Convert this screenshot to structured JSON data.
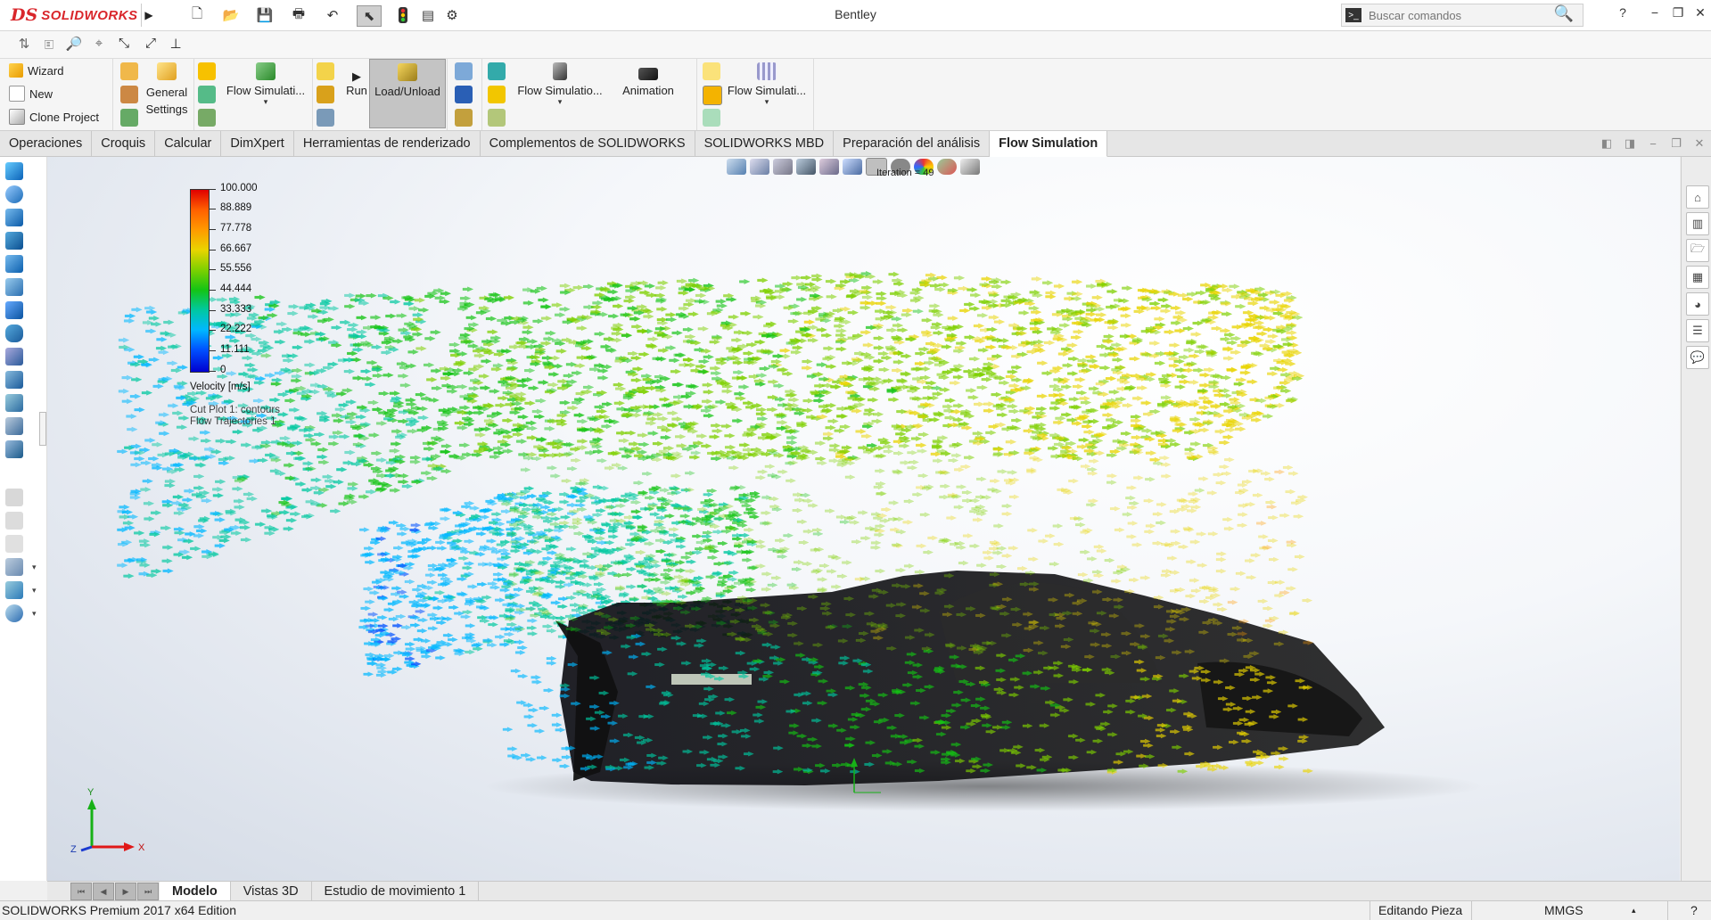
{
  "app": {
    "brand_prefix": "DS",
    "brand_name": "SOLIDWORKS",
    "document_title": "Bentley"
  },
  "search": {
    "placeholder": "Buscar comandos"
  },
  "window_controls": {
    "help": "?",
    "minimize": "−",
    "restore": "❐",
    "close": "✕"
  },
  "ribbon": {
    "wizard_label": "Wizard",
    "new_label": "New",
    "clone_label": "Clone Project",
    "general_settings_label": "General Settings",
    "flow_sim_1_label": "Flow Simulati...",
    "run_label": "Run",
    "load_unload_label": "Load/Unload",
    "flow_sim_2_label": "Flow Simulatio...",
    "animation_label": "Animation",
    "flow_sim_3_label": "Flow Simulati..."
  },
  "command_tabs": [
    {
      "label": "Operaciones",
      "active": false
    },
    {
      "label": "Croquis",
      "active": false
    },
    {
      "label": "Calcular",
      "active": false
    },
    {
      "label": "DimXpert",
      "active": false
    },
    {
      "label": "Herramientas de renderizado",
      "active": false
    },
    {
      "label": "Complementos de SOLIDWORKS",
      "active": false
    },
    {
      "label": "SOLIDWORKS MBD",
      "active": false
    },
    {
      "label": "Preparación del análisis",
      "active": false
    },
    {
      "label": "Flow Simulation",
      "active": true
    }
  ],
  "viewport": {
    "iteration_label": "Iteration = 49",
    "legend": {
      "values": [
        "100.000",
        "88.889",
        "77.778",
        "66.667",
        "55.556",
        "44.444",
        "33.333",
        "22.222",
        "11.111",
        "0"
      ],
      "units_label": "Velocity [m/s]",
      "plot_label_1": "Cut Plot 1: contours",
      "plot_label_2": "Flow Trajectories 1",
      "colors": [
        "#e00000",
        "#ff6000",
        "#ff9a00",
        "#e9d400",
        "#7ed000",
        "#14c414",
        "#00c8a0",
        "#00b8ff",
        "#0050ff",
        "#0000d0"
      ]
    },
    "triad": {
      "x": "X",
      "y": "Y",
      "z": "Z"
    }
  },
  "bottom_tabs": [
    {
      "label": "Modelo",
      "active": true
    },
    {
      "label": "Vistas 3D",
      "active": false
    },
    {
      "label": "Estudio de movimiento 1",
      "active": false
    }
  ],
  "status_bar": {
    "edition": "SOLIDWORKS Premium 2017 x64 Edition",
    "mode": "Editando Pieza",
    "units": "MMGS"
  }
}
